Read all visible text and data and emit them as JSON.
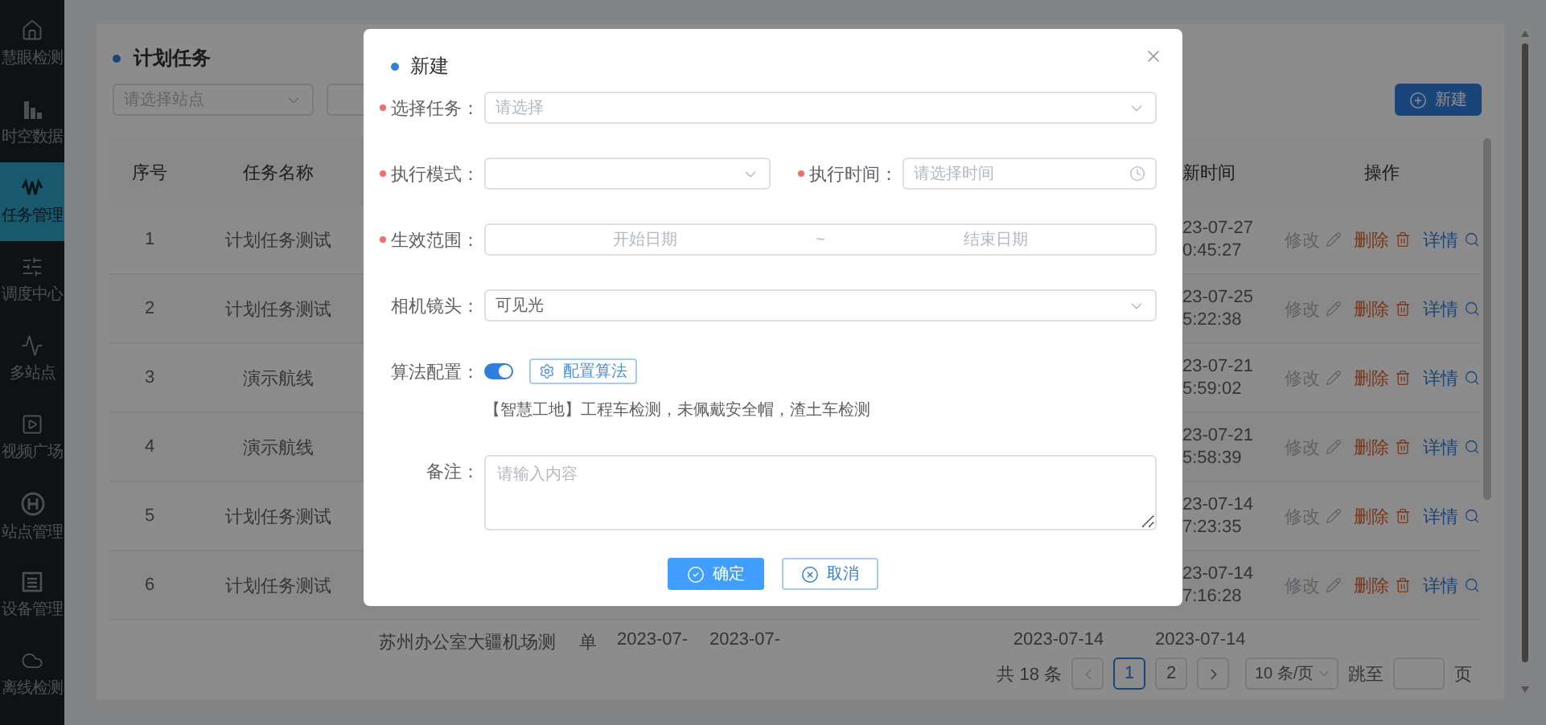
{
  "sidebar": {
    "items": [
      {
        "label": "慧眼检测",
        "selected": false
      },
      {
        "label": "时空数据",
        "selected": false
      },
      {
        "label": "任务管理",
        "selected": true
      },
      {
        "label": "调度中心",
        "selected": false
      },
      {
        "label": "多站点",
        "selected": false
      },
      {
        "label": "视频广场",
        "selected": false
      },
      {
        "label": "站点管理",
        "selected": false
      },
      {
        "label": "设备管理",
        "selected": false
      },
      {
        "label": "离线检测",
        "selected": false
      }
    ]
  },
  "page": {
    "title": "计划任务",
    "station_select": {
      "placeholder": "请选择站点"
    },
    "new_button": "新建"
  },
  "table": {
    "columns": [
      "序号",
      "任务名称",
      "新时间",
      "操作"
    ],
    "rows": [
      {
        "index": "1",
        "name": "计划任务测试",
        "updated_date": "23-07-27",
        "updated_time": "0:45:27",
        "actions": [
          {
            "kind": "edit",
            "label": "修改"
          },
          {
            "kind": "delete",
            "label": "删除"
          },
          {
            "kind": "detail",
            "label": "详情"
          }
        ]
      },
      {
        "index": "2",
        "name": "计划任务测试",
        "updated_date": "23-07-25",
        "updated_time": "5:22:38",
        "actions": [
          {
            "kind": "edit",
            "label": "修改"
          },
          {
            "kind": "delete",
            "label": "删除"
          },
          {
            "kind": "detail",
            "label": "详情"
          }
        ]
      },
      {
        "index": "3",
        "name": "演示航线",
        "updated_date": "23-07-21",
        "updated_time": "5:59:02",
        "actions": [
          {
            "kind": "edit",
            "label": "修改"
          },
          {
            "kind": "delete",
            "label": "删除"
          },
          {
            "kind": "detail",
            "label": "详情"
          }
        ]
      },
      {
        "index": "4",
        "name": "演示航线",
        "updated_date": "23-07-21",
        "updated_time": "5:58:39",
        "actions": [
          {
            "kind": "edit",
            "label": "修改"
          },
          {
            "kind": "delete",
            "label": "删除"
          },
          {
            "kind": "detail",
            "label": "详情"
          }
        ]
      },
      {
        "index": "5",
        "name": "计划任务测试",
        "updated_date": "23-07-14",
        "updated_time": "7:23:35",
        "actions": [
          {
            "kind": "edit",
            "label": "修改"
          },
          {
            "kind": "delete",
            "label": "删除"
          },
          {
            "kind": "detail",
            "label": "详情"
          }
        ]
      },
      {
        "index": "6",
        "name": "计划任务测试",
        "updated_date": "23-07-14",
        "updated_time": "7:16:28",
        "actions": [
          {
            "kind": "edit",
            "label": "修改"
          },
          {
            "kind": "delete",
            "label": "删除"
          },
          {
            "kind": "detail",
            "label": "详情"
          }
        ]
      }
    ],
    "partial_row": {
      "cells": [
        "苏州办公室大疆机场测",
        "单",
        "2023-07-",
        "2023-07-",
        "2023-07-14",
        "2023-07-14"
      ]
    }
  },
  "pagination": {
    "total": "共 18 条",
    "pages": [
      {
        "label": "1",
        "selected": true
      },
      {
        "label": "2",
        "selected": false
      }
    ],
    "page_size": "10 条/页",
    "jump_label": "跳至",
    "page_suffix": "页"
  },
  "dialog": {
    "title": "新建",
    "rows": [
      {
        "fields": [
          {
            "kind": "select",
            "label": "选择任务：",
            "required": true,
            "placeholder": "请选择"
          }
        ]
      },
      {
        "fields": [
          {
            "kind": "select",
            "label": "执行模式：",
            "required": true
          },
          {
            "kind": "time",
            "label": "执行时间：",
            "required": true,
            "placeholder": "请选择时间"
          }
        ]
      },
      {
        "fields": [
          {
            "kind": "daterange",
            "label": "生效范围：",
            "required": true,
            "start_placeholder": "开始日期",
            "separator": "~",
            "end_placeholder": "结束日期"
          }
        ]
      },
      {
        "fields": [
          {
            "kind": "select",
            "label": "相机镜头：",
            "required": false,
            "value": "可见光"
          }
        ]
      },
      {
        "fields": [
          {
            "kind": "switch",
            "label": "算法配置：",
            "required": false,
            "on": true,
            "button": "配置算法",
            "hint": "【智慧工地】工程车检测，未佩戴安全帽，渣土车检测"
          }
        ]
      },
      {
        "fields": [
          {
            "kind": "textarea",
            "label": "备注：",
            "required": false,
            "placeholder": "请输入内容"
          }
        ]
      }
    ],
    "buttons": [
      {
        "kind": "primary",
        "label": "确定"
      },
      {
        "kind": "secondary",
        "label": "取消"
      }
    ]
  }
}
